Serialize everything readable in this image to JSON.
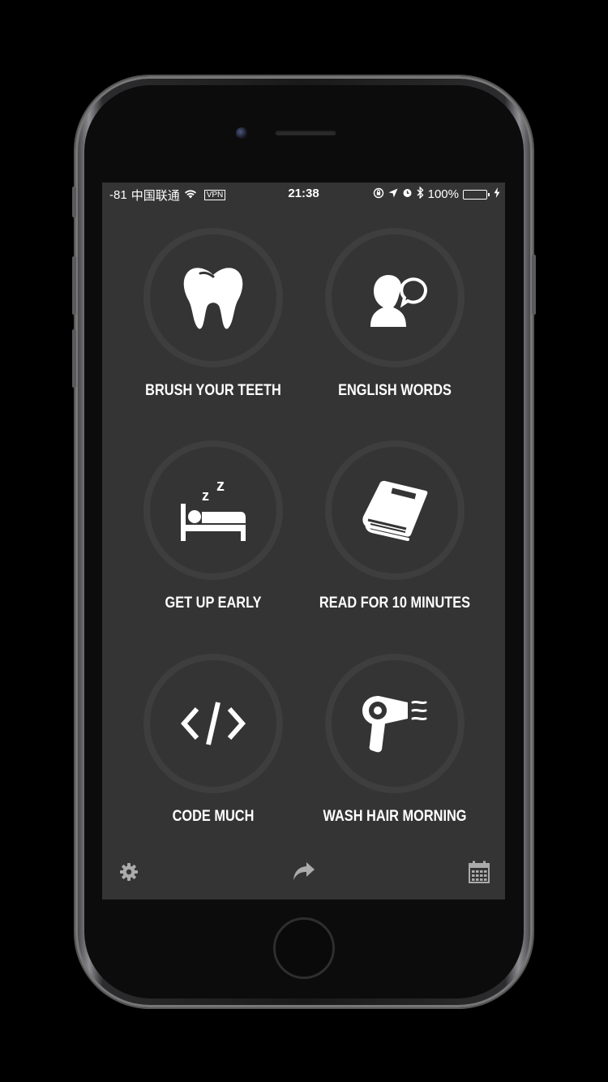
{
  "status_bar": {
    "signal": "-81",
    "carrier": "中国联通",
    "vpn": "VPN",
    "time": "21:38",
    "battery_percent": "100%"
  },
  "habits": [
    {
      "label": "BRUSH YOUR TEETH",
      "icon": "tooth-icon"
    },
    {
      "label": "ENGLISH WORDS",
      "icon": "speaking-person-icon"
    },
    {
      "label": "GET UP EARLY",
      "icon": "sleeping-bed-icon"
    },
    {
      "label": "READ FOR 10 MINUTES",
      "icon": "book-icon"
    },
    {
      "label": "CODE MUCH",
      "icon": "code-icon"
    },
    {
      "label": "WASH HAIR MORNING",
      "icon": "hair-dryer-icon"
    }
  ],
  "toolbar": {
    "left_icon": "gear-icon",
    "center_icon": "share-arrow-icon",
    "right_icon": "calendar-icon"
  },
  "colors": {
    "screen_background": "#343434",
    "ring": "#3e3e3e",
    "text": "#ffffff",
    "battery": "#4cd964"
  }
}
